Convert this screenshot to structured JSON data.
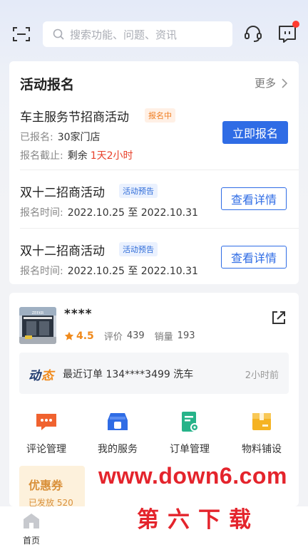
{
  "header": {
    "search_placeholder": "搜索功能、问题、资讯",
    "icons": [
      "scan-icon",
      "search-icon",
      "headset-icon",
      "message-icon"
    ],
    "notification_dot_color": "#ff3b30"
  },
  "activity": {
    "title": "活动报名",
    "more_label": "更多",
    "items": [
      {
        "name": "车主服务节招商活动",
        "tag": "报名中",
        "registered_label": "已报名:",
        "registered_value": "30家门店",
        "deadline_label": "报名截止:",
        "deadline_prefix": "剩余",
        "deadline_value": "1天2小时",
        "button": "立即报名"
      },
      {
        "name": "双十二招商活动",
        "tag": "活动预告",
        "time_label": "报名时间:",
        "time_value": "2022.10.25 至 2022.10.31",
        "button": "查看详情"
      },
      {
        "name": "双十二招商活动",
        "tag": "活动预告",
        "time_label": "报名时间:",
        "time_value": "2022.10.25 至 2022.10.31",
        "button": "查看详情"
      }
    ]
  },
  "shop": {
    "name": "****",
    "rating": "4.5",
    "review_label": "评价",
    "review_count": "439",
    "sales_label": "销量",
    "sales_count": "193",
    "feed": {
      "logo_a": "动",
      "logo_b": "态",
      "text": "最近订单 134****3499 洗车",
      "time": "2小时前"
    },
    "menu": [
      {
        "label": "评论管理",
        "icon": "comment-manage-icon",
        "color": "#f0622f"
      },
      {
        "label": "我的服务",
        "icon": "my-service-icon",
        "color": "#2f6ce5"
      },
      {
        "label": "订单管理",
        "icon": "order-manage-icon",
        "color": "#26b389"
      },
      {
        "label": "物料铺设",
        "icon": "material-icon",
        "color": "#f5b323"
      }
    ]
  },
  "coupon": {
    "title": "优惠券",
    "sub": "已发放 520"
  },
  "tabbar": {
    "home_label": "首页"
  },
  "watermark": {
    "url": "www.down6.com",
    "cn": "第六下载"
  },
  "colors": {
    "primary": "#2f6ce5",
    "deadline_red": "#e8402a",
    "tag_orange": "#ef7d21",
    "rating_orange": "#f08a1c"
  }
}
